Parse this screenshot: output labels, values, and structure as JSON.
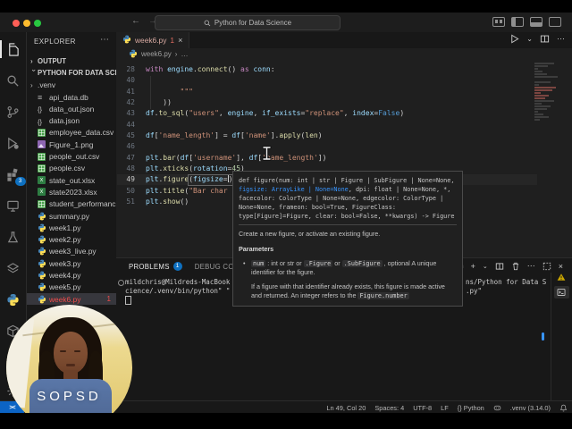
{
  "title_bar": {
    "command_center": "Python for Data Science",
    "traffic_lights": [
      "close",
      "minimize",
      "zoom"
    ],
    "nav_icons": [
      "arrow-left-icon",
      "arrow-right-icon"
    ],
    "right_icons": [
      "grid-icon",
      "layout-sidebar-left-icon",
      "layout-panel-icon",
      "layout-sidebar-right-icon"
    ]
  },
  "activity_bar": {
    "items": [
      {
        "icon": "files",
        "active": true
      },
      {
        "icon": "search"
      },
      {
        "icon": "source-control"
      },
      {
        "icon": "debug"
      },
      {
        "icon": "extensions",
        "badge": "3"
      },
      {
        "icon": "remote-explorer"
      },
      {
        "icon": "beaker"
      },
      {
        "icon": "layers"
      },
      {
        "icon": "python"
      },
      {
        "icon": "package"
      }
    ],
    "bottom_icon": "gear"
  },
  "sidebar": {
    "header": "EXPLORER",
    "more": "⋯",
    "tree": [
      {
        "name": "OUTPUT",
        "kind": "section",
        "chevron": "right"
      },
      {
        "name": "PYTHON FOR DATA SCIE...",
        "kind": "section",
        "chevron": "down"
      },
      {
        "name": ".venv",
        "kind": "folder",
        "chevron": "right"
      },
      {
        "name": "api_data.db",
        "kind": "db"
      },
      {
        "name": "data_out.json",
        "kind": "json"
      },
      {
        "name": "data.json",
        "kind": "json"
      },
      {
        "name": "employee_data.csv",
        "kind": "csv"
      },
      {
        "name": "Figure_1.png",
        "kind": "img"
      },
      {
        "name": "people_out.csv",
        "kind": "csv"
      },
      {
        "name": "people.csv",
        "kind": "csv"
      },
      {
        "name": "state_out.xlsx",
        "kind": "xlsx"
      },
      {
        "name": "state2023.xlsx",
        "kind": "xlsx"
      },
      {
        "name": "student_performanc...",
        "kind": "csv"
      },
      {
        "name": "summary.py",
        "kind": "py"
      },
      {
        "name": "week1.py",
        "kind": "py"
      },
      {
        "name": "week2.py",
        "kind": "py"
      },
      {
        "name": "week3_live.py",
        "kind": "py"
      },
      {
        "name": "week3.py",
        "kind": "py"
      },
      {
        "name": "week4.py",
        "kind": "py"
      },
      {
        "name": "week5.py",
        "kind": "py"
      },
      {
        "name": "week6.py",
        "kind": "py",
        "selected": true,
        "badge": "1"
      }
    ]
  },
  "editor": {
    "tab": {
      "label": "week6.py",
      "error_count": "1",
      "close": "×"
    },
    "actions": [
      "run-icon",
      "chevron-down-icon",
      "split-editor-icon",
      "ellipsis-icon"
    ],
    "breadcrumb": {
      "file": "week6.py",
      "sep": "›",
      "more": "…"
    },
    "lines": [
      {
        "n": "28",
        "seg": [
          [
            "with",
            "kw"
          ],
          [
            " ",
            ""
          ],
          [
            "engine",
            "var"
          ],
          [
            ".",
            ""
          ],
          [
            "connect",
            "fn"
          ],
          [
            "() ",
            ""
          ],
          [
            "as",
            "kw"
          ],
          [
            " ",
            ""
          ],
          [
            "conn",
            "var"
          ],
          [
            ":",
            ""
          ]
        ]
      },
      {
        "n": "40",
        "seg": []
      },
      {
        "n": "41",
        "seg": [
          [
            "        \"\"\"",
            "str"
          ]
        ]
      },
      {
        "n": "42",
        "seg": [
          [
            "    ))",
            ""
          ]
        ]
      },
      {
        "n": "43",
        "seg": [
          [
            "df",
            "var"
          ],
          [
            ".",
            ""
          ],
          [
            "to_sql",
            "fn"
          ],
          [
            "(",
            ""
          ],
          [
            "\"users\"",
            "str"
          ],
          [
            ", ",
            ""
          ],
          [
            "engine",
            "var"
          ],
          [
            ", ",
            ""
          ],
          [
            "if_exists",
            "param"
          ],
          [
            "=",
            ""
          ],
          [
            "\"replace\"",
            "str"
          ],
          [
            ", ",
            ""
          ],
          [
            "index",
            "param"
          ],
          [
            "=",
            ""
          ],
          [
            "False",
            "const"
          ],
          [
            ")",
            ""
          ]
        ]
      },
      {
        "n": "44",
        "seg": []
      },
      {
        "n": "45",
        "seg": [
          [
            "df",
            "var"
          ],
          [
            "[",
            ""
          ],
          [
            "'name_length'",
            "str"
          ],
          [
            "] = ",
            ""
          ],
          [
            "df",
            "var"
          ],
          [
            "[",
            ""
          ],
          [
            "'name'",
            "str"
          ],
          [
            "].",
            ""
          ],
          [
            "apply",
            "fn"
          ],
          [
            "(",
            ""
          ],
          [
            "len",
            "fn"
          ],
          [
            ")",
            ""
          ]
        ]
      },
      {
        "n": "46",
        "seg": []
      },
      {
        "n": "47",
        "seg": [
          [
            "plt",
            "var"
          ],
          [
            ".",
            ""
          ],
          [
            "bar",
            "fn"
          ],
          [
            "(",
            ""
          ],
          [
            "df",
            "var"
          ],
          [
            "[",
            ""
          ],
          [
            "'username'",
            "str"
          ],
          [
            "], ",
            ""
          ],
          [
            "df",
            "var"
          ],
          [
            "[",
            ""
          ],
          [
            "'name_length'",
            "str"
          ],
          [
            "])",
            ""
          ]
        ]
      },
      {
        "n": "48",
        "seg": [
          [
            "plt",
            "var"
          ],
          [
            ".",
            ""
          ],
          [
            "xticks",
            "fn"
          ],
          [
            "(",
            ""
          ],
          [
            "rotation",
            "param"
          ],
          [
            "=",
            ""
          ],
          [
            "45",
            "num"
          ],
          [
            ")",
            ""
          ]
        ]
      },
      {
        "n": "49",
        "current": true,
        "seg": [
          [
            "plt",
            "var"
          ],
          [
            ".",
            ""
          ],
          [
            "figure",
            "fn"
          ],
          [
            "(",
            ""
          ],
          [
            "figsize",
            "param"
          ],
          [
            "=",
            ""
          ],
          [
            "CARET",
            "caret"
          ],
          [
            ")",
            ""
          ]
        ]
      },
      {
        "n": "50",
        "seg": [
          [
            "plt",
            "var"
          ],
          [
            ".",
            ""
          ],
          [
            "title",
            "fn"
          ],
          [
            "(",
            ""
          ],
          [
            "\"Bar char",
            "str"
          ]
        ]
      },
      {
        "n": "51",
        "seg": [
          [
            "plt",
            "var"
          ],
          [
            ".",
            ""
          ],
          [
            "show",
            "fn"
          ],
          [
            "()",
            ""
          ]
        ]
      }
    ]
  },
  "tooltip": {
    "signature": [
      [
        [
          "def figure(num: int | str | Figure | SubFigure | None=None,",
          ""
        ]
      ],
      [
        [
          "figsize: ArrayLike | None=None",
          "hl"
        ],
        [
          ", dpi: float | None=None, *,",
          ""
        ]
      ],
      [
        [
          "facecolor: ColorType | None=None, edgecolor: ColorType |",
          ""
        ]
      ],
      [
        [
          "None=None, frameon: bool=True, FigureClass:",
          ""
        ]
      ],
      [
        [
          "type[Figure]=Figure, clear: bool=False, **kwargs) -> Figure",
          ""
        ]
      ]
    ],
    "summary": "Create a new figure, or activate an existing figure.",
    "params_heading": "Parameters",
    "bullet": [
      {
        "t": "num",
        "chip": true
      },
      {
        "t": " : int or str or "
      },
      {
        "t": ".Figure",
        "chip": true
      },
      {
        "t": " or "
      },
      {
        "t": ".SubFigure",
        "chip": true
      },
      {
        "t": " , optional A unique identifier for the figure."
      }
    ],
    "para": [
      {
        "t": "If a figure with that identifier already exists, this figure is made active and returned. An integer refers to the "
      },
      {
        "t": "Figure.number",
        "chip": true
      }
    ]
  },
  "panel": {
    "tabs": [
      {
        "label": "PROBLEMS",
        "badge": "1",
        "active": true
      },
      {
        "label": "DEBUG CONSOLE"
      }
    ],
    "terminal_profile": "python",
    "tool_icons": [
      "plus-icon",
      "chevron-down-icon",
      "split-terminal-icon",
      "trash-icon",
      "ellipsis-icon",
      "panel-restore-icon",
      "close-icon"
    ],
    "side_icons": [
      "warning-icon",
      "terminal-icon"
    ],
    "terminal": {
      "line1_left": "mildchris@Mildreds-MacBook",
      "line1_right": "ns/Python for Data S",
      "line2_left": "cience/.venv/bin/python\" \"",
      "line2_right": ".py\""
    }
  },
  "status_bar": {
    "remote_glyph": "><",
    "items": [
      {
        "t": "Ln 49, Col 20"
      },
      {
        "t": "Spaces: 4"
      },
      {
        "t": "UTF-8"
      },
      {
        "t": "LF"
      },
      {
        "t": "{} Python"
      },
      {
        "icon": "copilot"
      },
      {
        "t": ".venv (3.14.0)"
      },
      {
        "icon": "bell"
      }
    ]
  },
  "webcam": {
    "watermark": "SOPSD"
  },
  "colors": {
    "accent_blue": "#0e70c0",
    "error_red": "#f14c4c",
    "warning_yellow": "#cca700",
    "editor_bg": "#1f1f1f",
    "chrome_bg": "#181818"
  }
}
